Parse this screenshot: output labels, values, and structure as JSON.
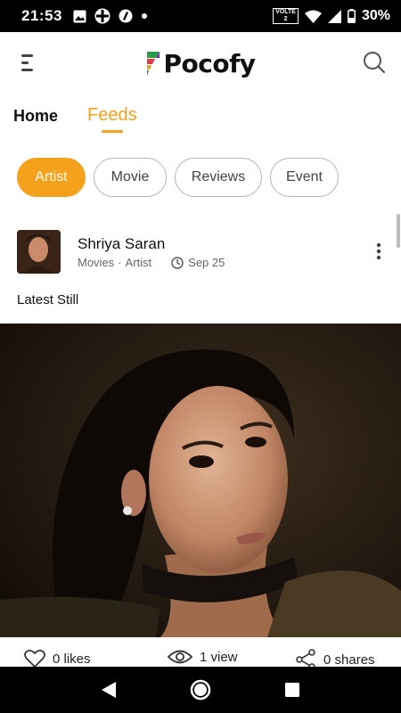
{
  "status_bar": {
    "time": "21:53",
    "battery": "30%",
    "network_badge_line1": "VOLTE",
    "network_badge_line2": "2"
  },
  "header": {
    "app_name": "Pocofy",
    "icons": [
      "menu-icon",
      "search-icon"
    ]
  },
  "main_tabs": [
    {
      "label": "Home",
      "active": false
    },
    {
      "label": "Feeds",
      "active": true
    }
  ],
  "filter_chips": [
    {
      "label": "Artist",
      "active": true
    },
    {
      "label": "Movie",
      "active": false
    },
    {
      "label": "Reviews",
      "active": false
    },
    {
      "label": "Event",
      "active": false
    }
  ],
  "post": {
    "author": "Shriya Saran",
    "category": "Movies",
    "subcategory": "Artist",
    "meta_separator": "·",
    "date": "Sep 25",
    "caption": "Latest Still",
    "likes": "0 likes",
    "views": "1 view",
    "shares": "0 shares"
  },
  "colors": {
    "accent": "#f5a11b",
    "status_bar_bg": "#000000",
    "chip_border": "#b5b5b5"
  }
}
